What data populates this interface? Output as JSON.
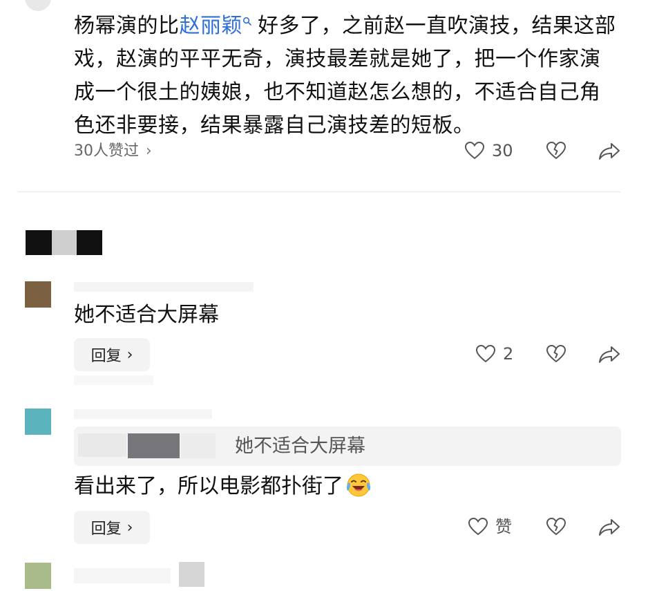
{
  "comment_main": {
    "text_before": "杨幂演的比",
    "keyword": "赵丽颖",
    "text_after": "好多了，之前赵一直吹演技，结果这部戏，赵演的平平无奇，演技最差就是她了，把一个作家演成一个很土的姨娘，也不知道赵怎么想的，不适合自己角色还非要接，结果暴露自己演技差的短板。",
    "likes_link": "30人赞过",
    "like_count": "30"
  },
  "reply_1": {
    "text": "她不适合大屏幕",
    "reply_label": "回复",
    "like_count": "2"
  },
  "reply_2": {
    "quoted_text": "她不适合大屏幕",
    "text": "看出来了，所以电影都扑街了",
    "reply_label": "回复",
    "like_label": "赞"
  },
  "colors": {
    "keyword": "#2f6fd8",
    "icon": "#555555",
    "secondary_text": "#666666"
  },
  "icons": [
    "search-icon",
    "chevron-right-icon",
    "heart-icon",
    "broken-heart-icon",
    "share-icon",
    "laughing-crying-emoji"
  ]
}
